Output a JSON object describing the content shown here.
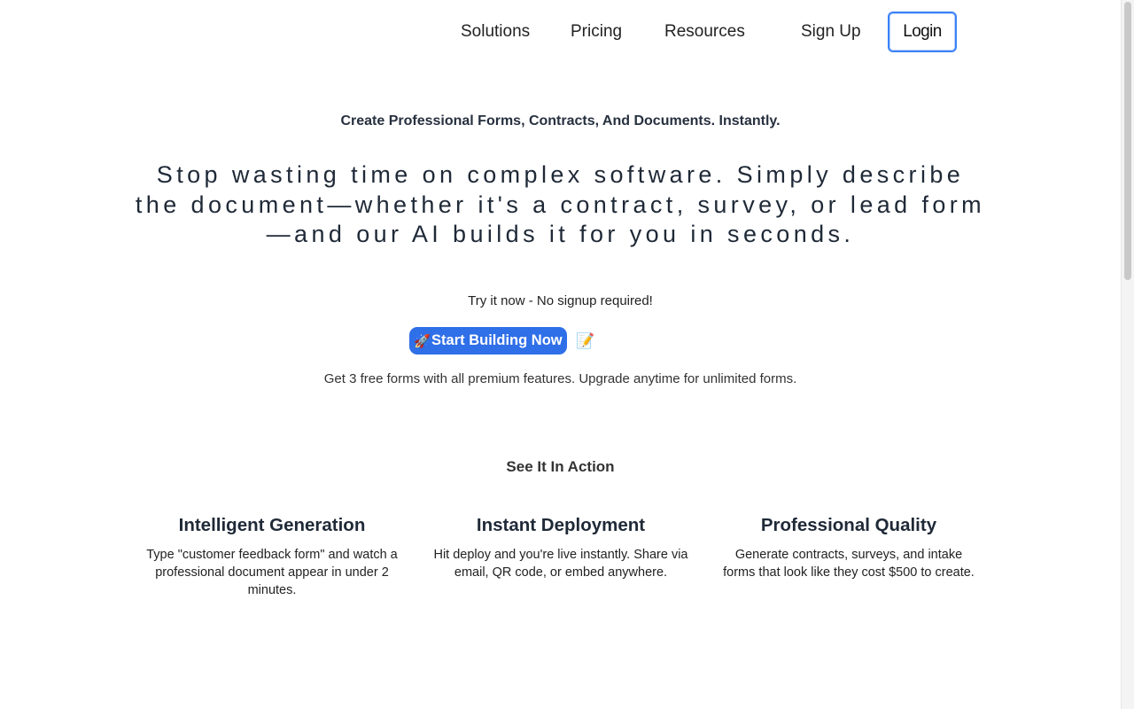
{
  "nav": {
    "solutions": "Solutions",
    "pricing": "Pricing",
    "resources": "Resources",
    "signup": "Sign Up",
    "login": "Login"
  },
  "hero": {
    "tagline": "Create Professional Forms, Contracts, And Documents. Instantly.",
    "headline": "Stop wasting time on complex software. Simply describe the document—whether it's a contract, survey, or lead form—and our AI builds it for you in seconds.",
    "try_text": "Try it now - No signup required!",
    "cta_icon": "🚀",
    "cta_label": "Start Building Now",
    "memo_icon": "📝",
    "free_text": "Get 3 free forms with all premium features. Upgrade anytime for unlimited forms."
  },
  "section": {
    "title": "See It In Action"
  },
  "features": [
    {
      "title": "Intelligent Generation",
      "body": "Type \"customer feedback form\" and watch a professional document appear in under 2 minutes."
    },
    {
      "title": "Instant Deployment",
      "body": "Hit deploy and you're live instantly. Share via email, QR code, or embed anywhere."
    },
    {
      "title": "Professional Quality",
      "body": "Generate contracts, surveys, and intake forms that look like they cost $500 to create."
    }
  ],
  "colors": {
    "accent": "#2f6fe8",
    "login_border": "#3b82f6"
  }
}
